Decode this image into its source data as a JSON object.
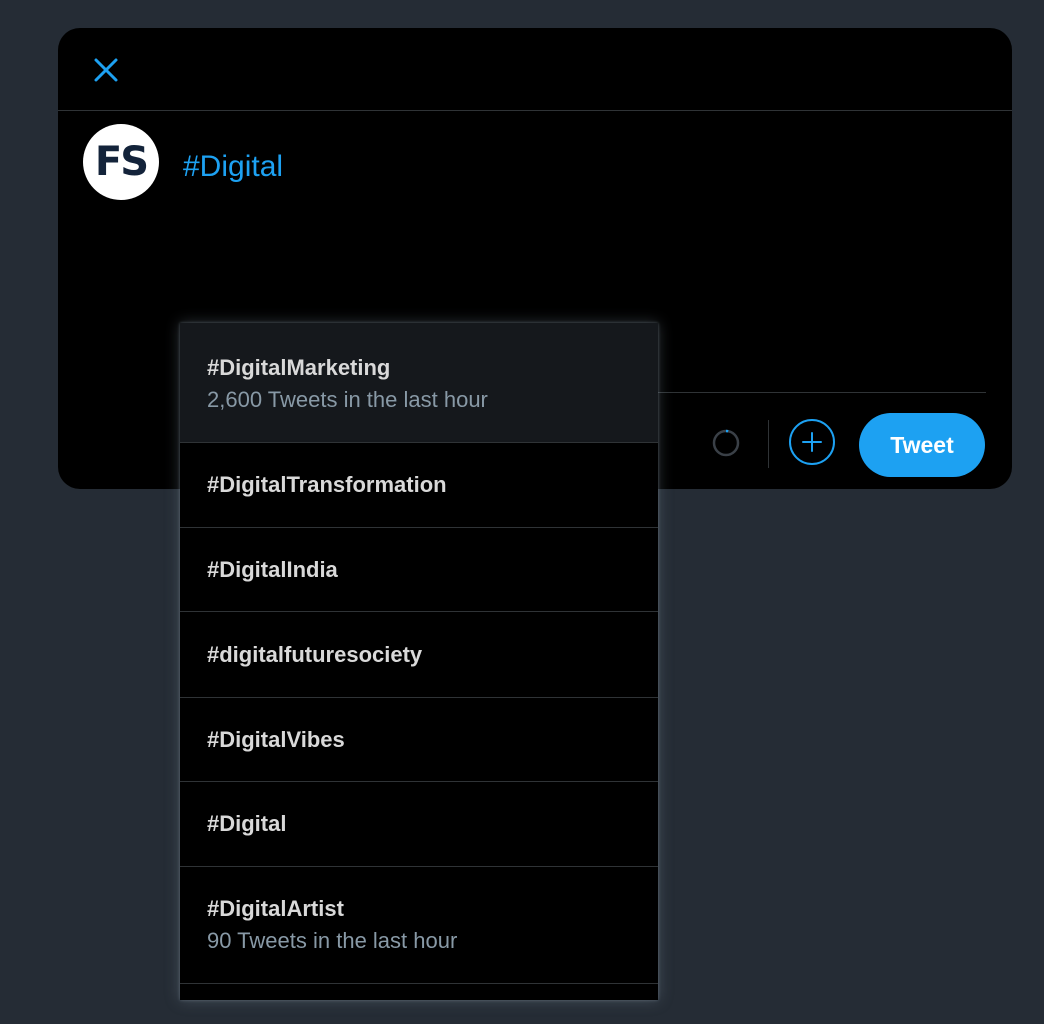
{
  "colors": {
    "accent": "#1da1f2",
    "background": "#252c35",
    "modal": "#000000",
    "muted": "#8899a6"
  },
  "header": {
    "close_icon": "close-icon"
  },
  "composer": {
    "avatar_initials": "FS",
    "text": "#Digital"
  },
  "toolbar": {
    "counter_icon": "progress-ring-icon",
    "add_icon": "plus-icon",
    "tweet_label": "Tweet"
  },
  "suggestions": [
    {
      "tag": "#DigitalMarketing",
      "count": "2,600 Tweets in the last hour"
    },
    {
      "tag": "#DigitalTransformation",
      "count": ""
    },
    {
      "tag": "#DigitalIndia",
      "count": ""
    },
    {
      "tag": "#digitalfuturesociety",
      "count": ""
    },
    {
      "tag": "#DigitalVibes",
      "count": ""
    },
    {
      "tag": "#Digital",
      "count": ""
    },
    {
      "tag": "#DigitalArtist",
      "count": "90 Tweets in the last hour"
    }
  ]
}
